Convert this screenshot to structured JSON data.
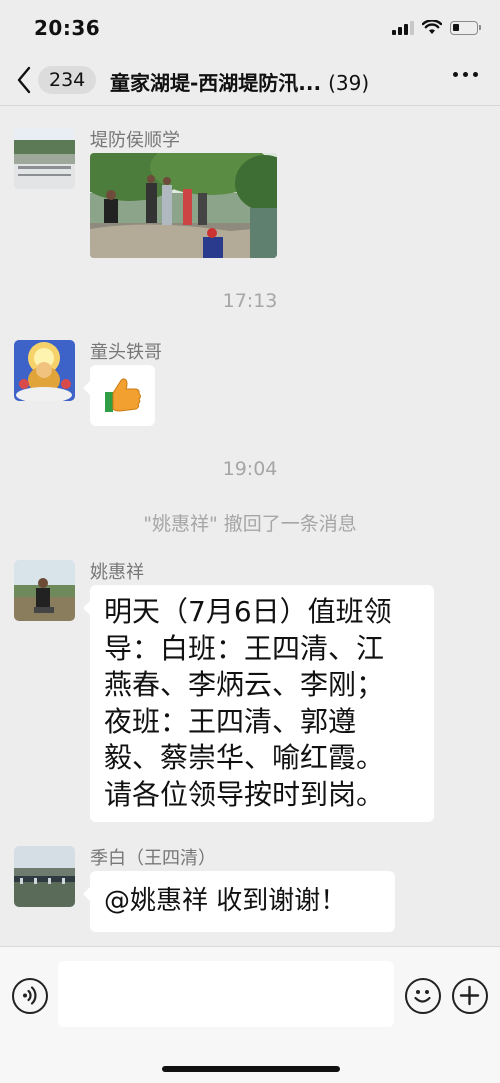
{
  "status_bar": {
    "time": "20:36"
  },
  "header": {
    "unread_count": "234",
    "title": "童家湖堤-西湖堤防汛...",
    "member_count": "(39)"
  },
  "messages": [
    {
      "sender": "堤防侯顺学",
      "type": "image"
    },
    {
      "timestamp": "17:13"
    },
    {
      "sender": "童头铁哥",
      "type": "emoji",
      "emoji": "👍"
    },
    {
      "timestamp": "19:04"
    },
    {
      "system": "\"姚惠祥\" 撤回了一条消息"
    },
    {
      "sender": "姚惠祥",
      "type": "text",
      "lines": [
        "明天（7月6日）值班领",
        "导：白班：王四清、江",
        "燕春、李炳云、李刚；",
        "夜班：王四清、郭遵",
        "毅、蔡崇华、喻红霞。",
        "请各位领导按时到岗。"
      ]
    },
    {
      "sender": "季白（王四清）",
      "type": "text",
      "lines": [
        "@姚惠祥 收到谢谢！"
      ]
    }
  ],
  "input": {
    "placeholder": ""
  },
  "icons": {
    "back": "chevron-left-icon",
    "more": "more-dots-icon",
    "voice": "voice-icon",
    "emoji": "emoji-icon",
    "add": "plus-icon"
  },
  "colors": {
    "background": "#ededed",
    "bubble": "#ffffff",
    "meta_text": "#a6a6a6"
  }
}
